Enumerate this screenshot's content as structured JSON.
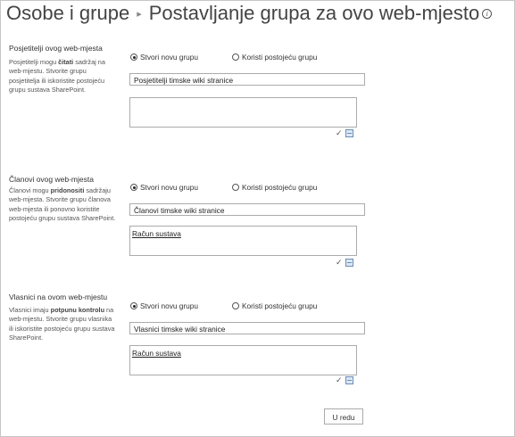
{
  "header": {
    "breadcrumb_root": "Osobe i grupe",
    "separator": "▸",
    "page_title": "Postavljanje grupa za ovo web-mjesto",
    "info_icon": "info-icon"
  },
  "radio_new_label": "Stvori novu grupu",
  "radio_existing_label": "Koristi postojeću grupu",
  "sections": [
    {
      "title": "Posjetitelji ovog web-mjesta",
      "desc_pre": "Posjetitelji mogu ",
      "desc_bold": "čitati",
      "desc_post": " sadržaj na web-mjestu. Stvorite grupu posjetitelja ili iskoristite postojeću grupu sustava SharePoint.",
      "selected": "new",
      "group_name": "Posjetitelji timske wiki stranice",
      "people": ""
    },
    {
      "title": "Članovi ovog web-mjesta",
      "desc_pre": "Članovi mogu ",
      "desc_bold": "pridonositi",
      "desc_post": " sadržaju web-mjesta. Stvorite grupu članova web-mjesta ili ponovno koristite postojeću grupu sustava SharePoint.",
      "selected": "new",
      "group_name": "Članovi timske wiki stranice",
      "people": "Račun sustava"
    },
    {
      "title": "Vlasnici na ovom web-mjestu",
      "desc_pre": "Vlasnici imaju ",
      "desc_bold": "potpunu kontrolu",
      "desc_post": " na web-mjestu. Stvorite grupu vlasnika ili iskoristite postojeću grupu sustava SharePoint.",
      "selected": "new",
      "group_name": "Vlasnici timske wiki stranice",
      "people": "Račun sustava"
    }
  ],
  "people_tools": {
    "check_names_icon": "check-names-icon",
    "browse_icon": "address-book-icon",
    "check_glyph": "✓"
  },
  "footer": {
    "ok_label": "U redu"
  }
}
